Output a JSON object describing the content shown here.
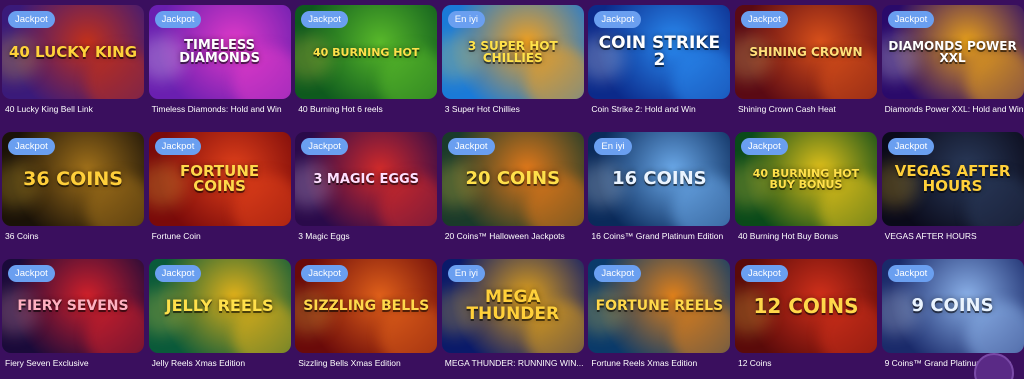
{
  "badges": {
    "jackpot": "Jackpot",
    "new": "En iyi"
  },
  "games": [
    {
      "name": "40 Lucky King Bell Link",
      "badge": "jackpot",
      "art": "40 Lucky King",
      "bg": [
        "#3a1a7a",
        "#c2301a"
      ],
      "fg": "#ffd23a",
      "size": 15
    },
    {
      "name": "Timeless Diamonds: Hold and Win",
      "badge": "jackpot",
      "art": "Timeless Diamonds",
      "bg": [
        "#6a1fb0",
        "#e03ac8"
      ],
      "fg": "#ffffff",
      "size": 13
    },
    {
      "name": "40 Burning Hot 6 reels",
      "badge": "jackpot",
      "art": "40 Burning Hot",
      "bg": [
        "#0e5a1e",
        "#58b82a"
      ],
      "fg": "#ffe04a",
      "size": 11
    },
    {
      "name": "3 Super Hot Chillies",
      "badge": "new",
      "art": "3 Super Hot Chillies",
      "bg": [
        "#1a7ad8",
        "#f0a020"
      ],
      "fg": "#ffe24a",
      "size": 12
    },
    {
      "name": "Coin Strike 2: Hold and Win",
      "badge": "jackpot",
      "art": "Coin Strike 2",
      "bg": [
        "#0b2a8a",
        "#2a8af0"
      ],
      "fg": "#ffffff",
      "size": 17
    },
    {
      "name": "Shining Crown Cash Heat",
      "badge": "jackpot",
      "art": "Shining Crown",
      "bg": [
        "#5a0a14",
        "#d8501a"
      ],
      "fg": "#ffe07a",
      "size": 12
    },
    {
      "name": "Diamonds Power XXL: Hold and Win",
      "badge": "jackpot",
      "art": "Diamonds Power XXL",
      "bg": [
        "#2a0a6a",
        "#e8a01a"
      ],
      "fg": "#ffffff",
      "size": 12
    },
    {
      "name": "36 Coins",
      "badge": "jackpot",
      "art": "36 Coins",
      "bg": [
        "#1a1208",
        "#a0701a"
      ],
      "fg": "#ffcf3a",
      "size": 19
    },
    {
      "name": "Fortune Coin",
      "badge": "jackpot",
      "art": "Fortune Coins",
      "bg": [
        "#7a0a0a",
        "#e0401a"
      ],
      "fg": "#ffd84a",
      "size": 15
    },
    {
      "name": "3 Magic Eggs",
      "badge": "jackpot",
      "art": "3 Magic Eggs",
      "bg": [
        "#2a0a4a",
        "#d02a2a"
      ],
      "fg": "#ffe0ff",
      "size": 13
    },
    {
      "name": "20 Coins™ Halloween Jackpots",
      "badge": "jackpot",
      "art": "20 Coins",
      "bg": [
        "#1a3a2a",
        "#e0781a"
      ],
      "fg": "#ffe04a",
      "size": 18
    },
    {
      "name": "16 Coins™ Grand Platinum Edition",
      "badge": "new",
      "art": "16 Coins",
      "bg": [
        "#0a2a5a",
        "#6aa8e8"
      ],
      "fg": "#eaf4ff",
      "size": 18
    },
    {
      "name": "40 Burning Hot Buy Bonus",
      "badge": "jackpot",
      "art": "40 Burning Hot Buy Bonus",
      "bg": [
        "#0a4a1a",
        "#e0c01a"
      ],
      "fg": "#ffe04a",
      "size": 11
    },
    {
      "name": "VEGAS AFTER HOURS",
      "badge": "jackpot",
      "art": "Vegas After Hours",
      "bg": [
        "#0a0a1a",
        "#2a3a5a"
      ],
      "fg": "#ffd03a",
      "size": 15
    },
    {
      "name": "Fiery Seven Exclusive",
      "badge": "jackpot",
      "art": "Fiery Sevens",
      "bg": [
        "#1a0a3a",
        "#d0202a"
      ],
      "fg": "#ffb0c0",
      "size": 14
    },
    {
      "name": "Jelly Reels Xmas Edition",
      "badge": "jackpot",
      "art": "Jelly Reels",
      "bg": [
        "#0a5a3a",
        "#e0b01a"
      ],
      "fg": "#ffe04a",
      "size": 16
    },
    {
      "name": "Sizzling Bells Xmas Edition",
      "badge": "jackpot",
      "art": "Sizzling Bells",
      "bg": [
        "#6a0a0a",
        "#e0601a"
      ],
      "fg": "#ffd84a",
      "size": 14
    },
    {
      "name": "MEGA THUNDER: RUNNING WIN...",
      "badge": "new",
      "art": "Mega Thunder",
      "bg": [
        "#0a1a6a",
        "#e0a01a"
      ],
      "fg": "#ffd03a",
      "size": 17
    },
    {
      "name": "Fortune Reels Xmas Edition",
      "badge": "jackpot",
      "art": "Fortune Reels",
      "bg": [
        "#0a3a6a",
        "#e0801a"
      ],
      "fg": "#ffd84a",
      "size": 14
    },
    {
      "name": "12 Coins",
      "badge": "jackpot",
      "art": "12 Coins",
      "bg": [
        "#5a0a0a",
        "#d0301a"
      ],
      "fg": "#ffd84a",
      "size": 20
    },
    {
      "name": "9 Coins™ Grand Platinum Edition",
      "badge": "jackpot",
      "art": "9 Coins",
      "bg": [
        "#1a2a6a",
        "#8ab0e8"
      ],
      "fg": "#eaf4ff",
      "size": 18
    }
  ]
}
